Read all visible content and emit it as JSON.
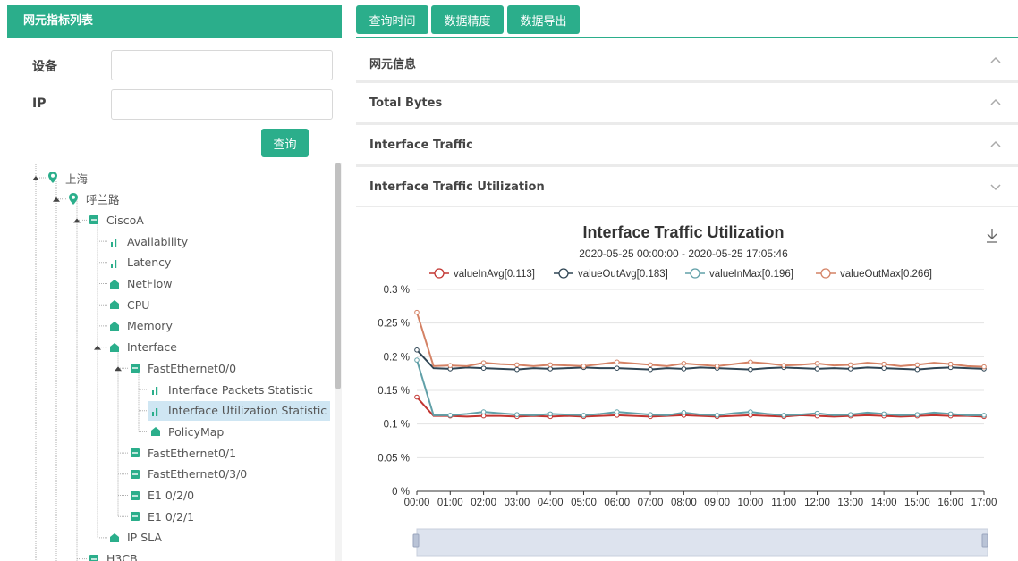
{
  "left": {
    "header": "网元指标列表",
    "fields": [
      {
        "label": "设备",
        "value": "",
        "placeholder": ""
      },
      {
        "label": "IP",
        "value": "",
        "placeholder": ""
      }
    ],
    "query_button": "查询"
  },
  "tree": {
    "nodes": [
      {
        "label": "上海",
        "icon": "location-pin-icon"
      },
      {
        "label": "呼兰路",
        "icon": "location-pin-icon"
      },
      {
        "label": "CiscoA",
        "icon": "device-icon"
      },
      {
        "label": "Availability",
        "icon": "bar-chart-icon"
      },
      {
        "label": "Latency",
        "icon": "bar-chart-icon"
      },
      {
        "label": "NetFlow",
        "icon": "folder-icon"
      },
      {
        "label": "CPU",
        "icon": "folder-icon"
      },
      {
        "label": "Memory",
        "icon": "folder-icon"
      },
      {
        "label": "Interface",
        "icon": "folder-icon"
      },
      {
        "label": "FastEthernet0/0",
        "icon": "device-icon"
      },
      {
        "label": "Interface Packets Statistic",
        "icon": "bar-chart-icon"
      },
      {
        "label": "Interface Utilization Statistic",
        "icon": "bar-chart-icon"
      },
      {
        "label": "PolicyMap",
        "icon": "folder-icon"
      },
      {
        "label": "FastEthernet0/1",
        "icon": "device-icon"
      },
      {
        "label": "FastEthernet0/3/0",
        "icon": "device-icon"
      },
      {
        "label": "E1 0/2/0",
        "icon": "device-icon"
      },
      {
        "label": "E1 0/2/1",
        "icon": "device-icon"
      },
      {
        "label": "IP SLA",
        "icon": "folder-icon"
      },
      {
        "label": "H3CB",
        "icon": "device-icon"
      }
    ],
    "selected": "Interface Utilization Statistic"
  },
  "toolbar": {
    "query_time": "查询时间",
    "data_precision": "数据精度",
    "data_export": "数据导出"
  },
  "accordion": [
    {
      "title": "网元信息",
      "state": "collapsed",
      "chevron": "chevron-up-icon"
    },
    {
      "title": "Total Bytes",
      "state": "collapsed",
      "chevron": "chevron-up-icon"
    },
    {
      "title": "Interface Traffic",
      "state": "collapsed",
      "chevron": "chevron-up-icon"
    },
    {
      "title": "Interface Traffic Utilization",
      "state": "expanded",
      "chevron": "chevron-down-icon"
    }
  ],
  "colors": {
    "accent": "#2bae8b",
    "valueInAvg": "#c23531",
    "valueOutAvg": "#2f4554",
    "valueInMax": "#61a0a8",
    "valueOutMax": "#d48265",
    "selected_bg": "#cfe6f3"
  },
  "chart_data": {
    "type": "line",
    "title": "Interface Traffic Utilization",
    "subtitle": "2020-05-25 00:00:00 - 2020-05-25 17:05:46",
    "ylabel": "",
    "xlabel": "",
    "legend_position": "top",
    "grid": true,
    "ylim": [
      0,
      0.3
    ],
    "y_ticks": [
      "0 %",
      "0.05 %",
      "0.1 %",
      "0.15 %",
      "0.2 %",
      "0.25 %",
      "0.3 %"
    ],
    "x_ticks": [
      "00:00",
      "01:00",
      "02:00",
      "03:00",
      "04:00",
      "05:00",
      "06:00",
      "07:00",
      "08:00",
      "09:00",
      "10:00",
      "11:00",
      "12:00",
      "13:00",
      "14:00",
      "15:00",
      "16:00",
      "17:00"
    ],
    "x": [
      0,
      0.5,
      1,
      1.5,
      2,
      2.5,
      3,
      3.5,
      4,
      4.5,
      5,
      5.5,
      6,
      6.5,
      7,
      7.5,
      8,
      8.5,
      9,
      9.5,
      10,
      10.5,
      11,
      11.5,
      12,
      12.5,
      13,
      13.5,
      14,
      14.5,
      15,
      15.5,
      16,
      16.5,
      17
    ],
    "series": [
      {
        "name": "valueInAvg[0.113]",
        "color": "#c23531",
        "values": [
          0.14,
          0.112,
          0.112,
          0.111,
          0.112,
          0.112,
          0.111,
          0.112,
          0.111,
          0.112,
          0.111,
          0.112,
          0.113,
          0.112,
          0.111,
          0.112,
          0.113,
          0.112,
          0.111,
          0.112,
          0.113,
          0.112,
          0.111,
          0.113,
          0.112,
          0.111,
          0.112,
          0.113,
          0.112,
          0.111,
          0.112,
          0.113,
          0.112,
          0.112,
          0.111
        ]
      },
      {
        "name": "valueOutAvg[0.183]",
        "color": "#2f4554",
        "values": [
          0.21,
          0.183,
          0.182,
          0.184,
          0.183,
          0.182,
          0.181,
          0.183,
          0.182,
          0.183,
          0.184,
          0.183,
          0.183,
          0.182,
          0.181,
          0.183,
          0.182,
          0.184,
          0.183,
          0.182,
          0.181,
          0.183,
          0.184,
          0.183,
          0.182,
          0.183,
          0.182,
          0.184,
          0.183,
          0.182,
          0.181,
          0.183,
          0.184,
          0.183,
          0.182
        ]
      },
      {
        "name": "valueInMax[0.196]",
        "color": "#61a0a8",
        "values": [
          0.195,
          0.113,
          0.113,
          0.115,
          0.118,
          0.116,
          0.114,
          0.113,
          0.115,
          0.114,
          0.113,
          0.115,
          0.118,
          0.116,
          0.114,
          0.113,
          0.117,
          0.114,
          0.113,
          0.116,
          0.118,
          0.115,
          0.113,
          0.114,
          0.116,
          0.113,
          0.114,
          0.117,
          0.115,
          0.113,
          0.114,
          0.117,
          0.115,
          0.113,
          0.113
        ]
      },
      {
        "name": "valueOutMax[0.266]",
        "color": "#d48265",
        "values": [
          0.266,
          0.186,
          0.187,
          0.186,
          0.191,
          0.189,
          0.188,
          0.186,
          0.188,
          0.187,
          0.186,
          0.189,
          0.192,
          0.19,
          0.188,
          0.186,
          0.19,
          0.188,
          0.186,
          0.189,
          0.192,
          0.19,
          0.187,
          0.188,
          0.19,
          0.187,
          0.188,
          0.191,
          0.189,
          0.186,
          0.188,
          0.191,
          0.189,
          0.186,
          0.185
        ]
      }
    ]
  }
}
